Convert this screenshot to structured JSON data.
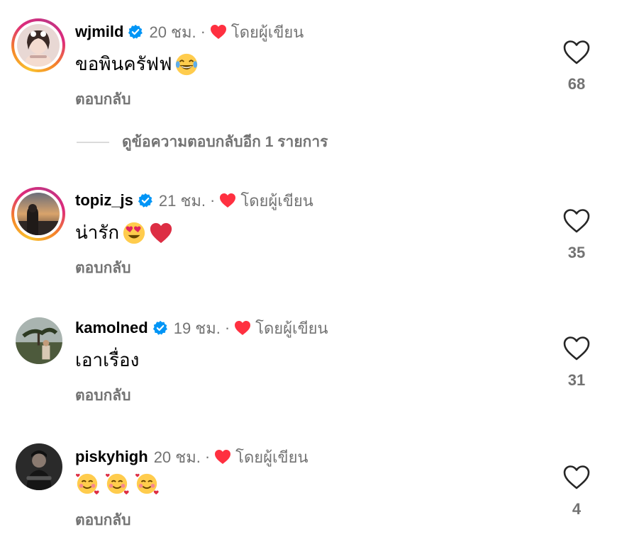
{
  "comments": [
    {
      "username": "wjmild",
      "verified": true,
      "time": "20 ชม.",
      "separator": "·",
      "by_author_label": "โดยผู้เขียน",
      "text": "ขอพินครัฟฟ",
      "emojis": [
        "joy-emoji"
      ],
      "reply_label": "ตอบกลับ",
      "likes": "68",
      "story_ring": true
    },
    {
      "username": "topiz_js",
      "verified": true,
      "time": "21 ชม.",
      "separator": "·",
      "by_author_label": "โดยผู้เขียน",
      "text": "น่ารัก",
      "emojis": [
        "heart-eyes-emoji",
        "red-heart-emoji"
      ],
      "reply_label": "ตอบกลับ",
      "likes": "35",
      "story_ring": true
    },
    {
      "username": "kamolned",
      "verified": true,
      "time": "19 ชม.",
      "separator": "·",
      "by_author_label": "โดยผู้เขียน",
      "text": "เอาเรื่อง",
      "emojis": [],
      "reply_label": "ตอบกลับ",
      "likes": "31",
      "story_ring": false
    },
    {
      "username": "piskyhigh",
      "verified": false,
      "time": "20 ชม.",
      "separator": "·",
      "by_author_label": "โดยผู้เขียน",
      "text": "",
      "emojis": [
        "smiling-hearts-emoji",
        "smiling-hearts-emoji",
        "smiling-hearts-emoji"
      ],
      "reply_label": "ตอบกลับ",
      "likes": "4",
      "story_ring": false
    }
  ],
  "view_more_replies": "ดูข้อความตอบกลับอีก 1 รายการ",
  "colors": {
    "secondary_text": "#737373",
    "verified_blue": "#0095f6",
    "author_heart": "#ff3040",
    "divider": "#dbdbdb"
  },
  "icons": {
    "verified": "verified-badge-icon",
    "author_heart": "red-heart-icon",
    "like": "heart-outline-icon"
  }
}
